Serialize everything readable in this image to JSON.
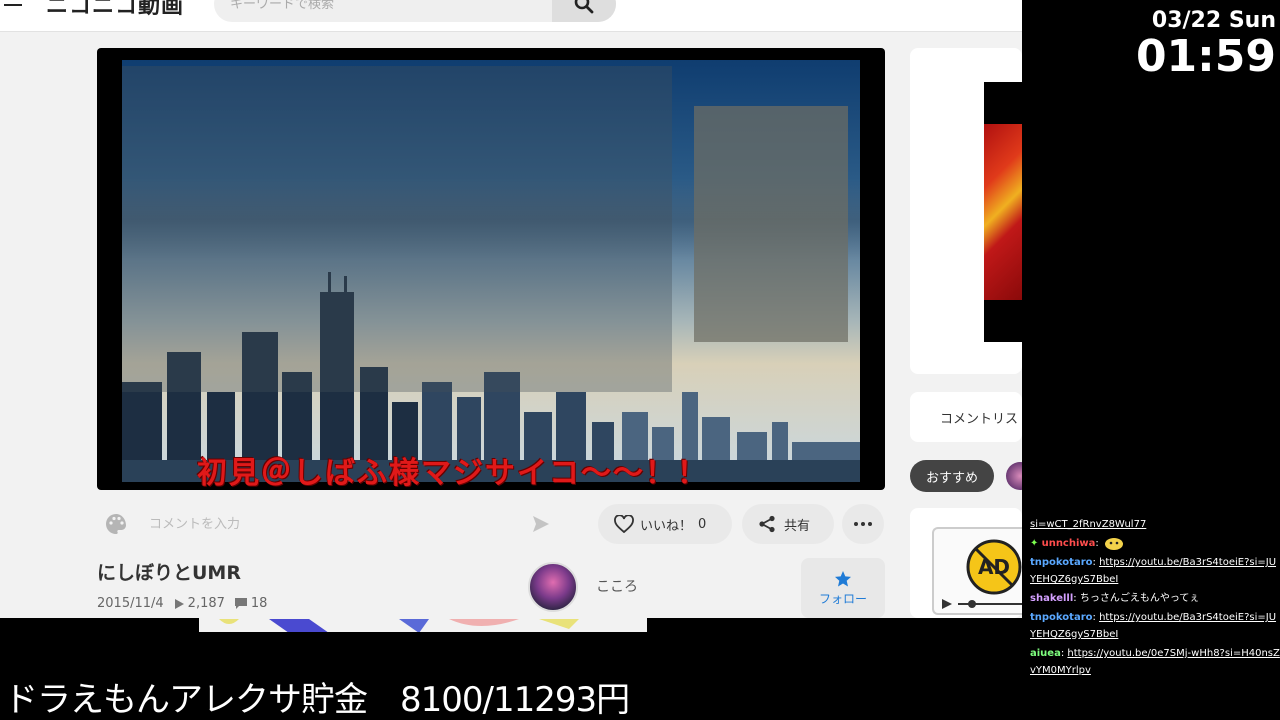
{
  "site": {
    "logo": "ニコニコ動画",
    "search_placeholder": "キーワードで検索",
    "comment_placeholder": "コメントを入力",
    "danmaku": "初見＠しばふ様マジサイコ～～！！",
    "like_label": "いいね！",
    "like_count": "0",
    "share_label": "共有",
    "video_title": "にしぼりとUMR",
    "upload_date": "2015/11/4",
    "views": "2,187",
    "comments": "18",
    "channel_name": "こころ",
    "follow_label": "フォロー",
    "comment_toggle_label": "コメントリスト",
    "tab_recommended": "おすすめ",
    "ad_label": "AD"
  },
  "overlay": {
    "date": "03/22 Sun",
    "time": "01:59",
    "savings_text": "ドラえもんアレクサ貯金　8100/11293円"
  },
  "chat": [
    {
      "user": "",
      "text": "si=wCT_2fRnvZ8Wul77",
      "user_color": "#ffffff"
    },
    {
      "user": "unnchiwa",
      "text": "",
      "user_color": "#ff4d4d",
      "icon": "sparkle-icon"
    },
    {
      "user": "tnpokotaro",
      "text": "https://youtu.be/Ba3rS4toeiE?si=JUYEHQZ6gyS7BbeI",
      "user_color": "#5aa8ff"
    },
    {
      "user": "shakelll",
      "text": "ちっさんごえもんやってぇ",
      "user_color": "#d4a0ff"
    },
    {
      "user": "tnpokotaro",
      "text": "https://youtu.be/Ba3rS4toeiE?si=JUYEHQZ6gyS7BbeI",
      "user_color": "#5aa8ff"
    },
    {
      "user": "aiuea",
      "text": "https://youtu.be/0e7SMj-wHh8?si=H40nsZvYM0MYrlpv",
      "user_color": "#7fff7f"
    }
  ]
}
